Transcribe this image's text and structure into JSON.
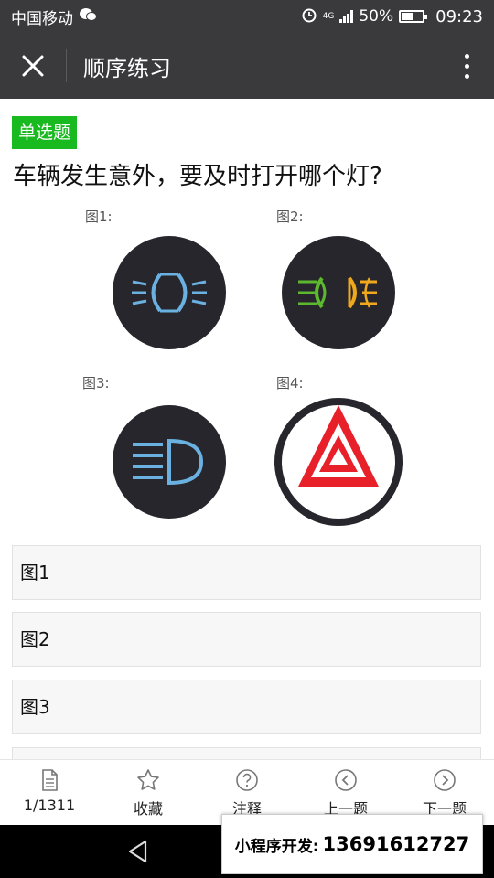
{
  "status_bar": {
    "carrier": "中国移动",
    "network": "4G",
    "battery": "50%",
    "battery_level": 0.5,
    "time": "09:23"
  },
  "nav": {
    "title": "顺序练习"
  },
  "question": {
    "type_badge": "单选题",
    "text": "车辆发生意外，要及时打开哪个灯?",
    "figure_labels": [
      "图1:",
      "图2:",
      "图3:",
      "图4:"
    ]
  },
  "options": [
    {
      "label": "图1"
    },
    {
      "label": "图2"
    },
    {
      "label": "图3"
    }
  ],
  "tabs": [
    {
      "label": "1/1311",
      "icon": "document-icon"
    },
    {
      "label": "收藏",
      "icon": "star-icon"
    },
    {
      "label": "注释",
      "icon": "question-circle-icon"
    },
    {
      "label": "上一题",
      "icon": "chevron-left-circle-icon"
    },
    {
      "label": "下一题",
      "icon": "chevron-right-circle-icon"
    }
  ],
  "promo": {
    "label": "小程序开发:",
    "phone": "13691612727"
  },
  "colors": {
    "bar_dark": "#3a3a3c",
    "badge_green": "#19b920",
    "lamp_blue": "#6ab0e0",
    "fog_green": "#5cb82e",
    "fog_amber": "#f0a81c",
    "hazard_red": "#e8202a"
  }
}
